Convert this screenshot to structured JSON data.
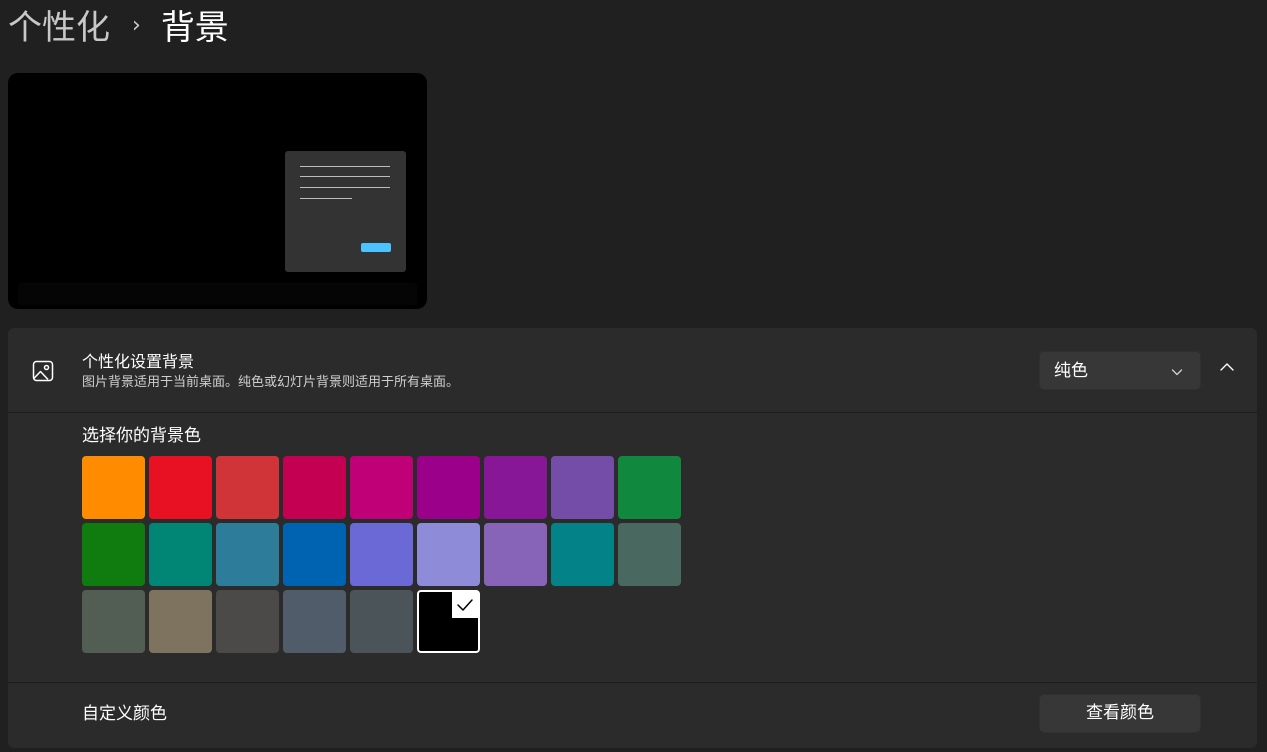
{
  "breadcrumb": {
    "parent": "个性化",
    "separator": "›",
    "current": "背景"
  },
  "preview": {
    "background_color": "#000000",
    "window_accent_color": "#4cc2ff"
  },
  "background_setting": {
    "icon": "image-icon",
    "title": "个性化设置背景",
    "description": "图片背景适用于当前桌面。纯色或幻灯片背景则适用于所有桌面。",
    "dropdown_value": "纯色",
    "dropdown_icon": "chevron-down-icon",
    "expand_icon": "chevron-up-icon",
    "expanded": true
  },
  "color_picker": {
    "label": "选择你的背景色",
    "selected_index": 23,
    "colors": [
      "#ff8c00",
      "#e81123",
      "#d13438",
      "#c30052",
      "#bf0077",
      "#9a0089",
      "#881798",
      "#744da9",
      "#10893e",
      "#107c10",
      "#018574",
      "#2d7d9a",
      "#0063b1",
      "#6b69d6",
      "#8e8cd8",
      "#8764b8",
      "#038387",
      "#486860",
      "#525e54",
      "#7e735f",
      "#4c4a48",
      "#515c6b",
      "#4a5459",
      "#000000"
    ]
  },
  "custom_color": {
    "label": "自定义颜色",
    "button_label": "查看颜色"
  }
}
